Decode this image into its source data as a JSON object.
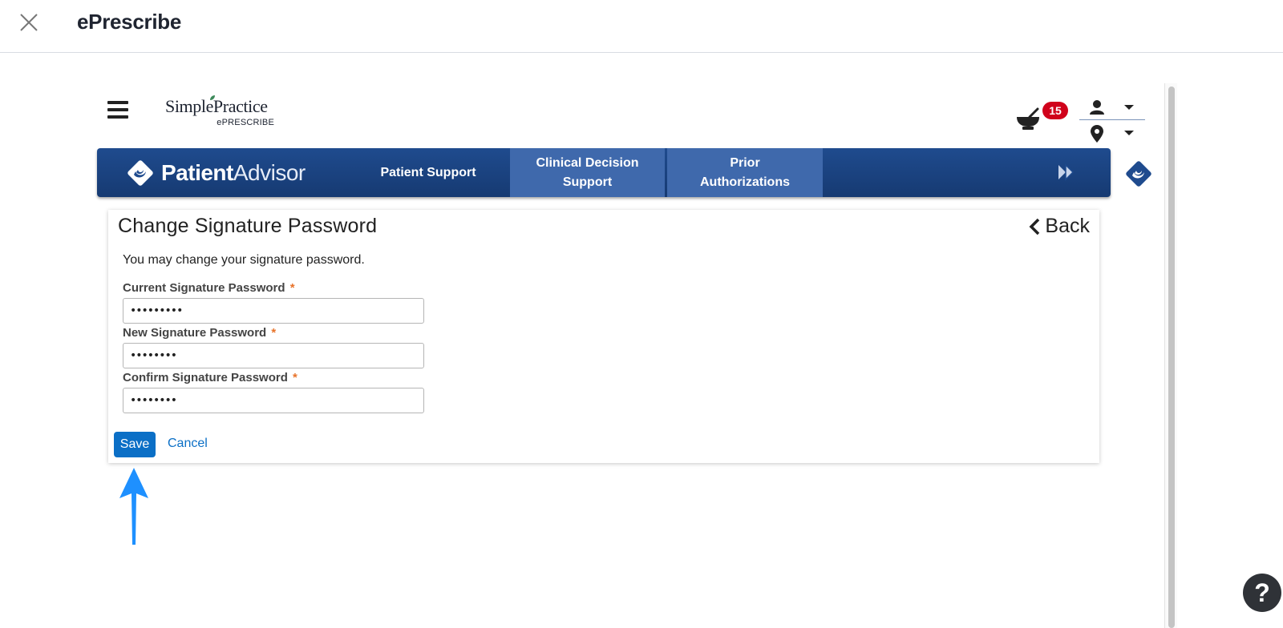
{
  "modal": {
    "title": "ePrescribe"
  },
  "app": {
    "brand": "SimplePractice",
    "brand_sub": "ePRESCRIBE",
    "rx_badge_count": "15"
  },
  "navbar": {
    "logo_bold": "Patient",
    "logo_light": "Advisor",
    "tabs": [
      {
        "label": "Patient Support",
        "active": false
      },
      {
        "label": "Clinical Decision Support",
        "line1": "Clinical Decision",
        "line2": "Support",
        "active": true
      },
      {
        "label": "Prior Authorizations",
        "line1": "Prior",
        "line2": "Authorizations",
        "active": true
      }
    ]
  },
  "form": {
    "title": "Change Signature Password",
    "back_label": "Back",
    "intro": "You may change your signature password.",
    "fields": [
      {
        "label": "Current Signature Password",
        "value": "•••••••••"
      },
      {
        "label": "New Signature Password",
        "value": "••••••••"
      },
      {
        "label": "Confirm Signature Password",
        "value": "••••••••"
      }
    ],
    "required_marker": "*",
    "save_label": "Save",
    "cancel_label": "Cancel"
  },
  "help": {
    "label": "?"
  },
  "colors": {
    "navbar": "#1f4b8e",
    "nav_active": "#3f69ac",
    "primary": "#0b6fc6",
    "badge": "#d0021b",
    "required": "#e8732a",
    "arrow": "#1e90ff"
  },
  "icons": [
    "close-icon",
    "hamburger-icon",
    "mortar-pestle-icon",
    "user-icon",
    "location-pin-icon",
    "chevron-left-icon",
    "double-chevron-right-icon",
    "patient-advisor-icon",
    "help-icon"
  ]
}
